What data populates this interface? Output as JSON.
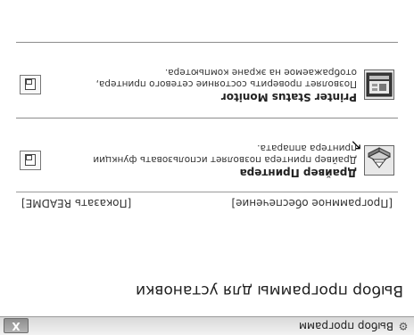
{
  "window": {
    "title": "Выбор программ",
    "title_icon": "gear-icon",
    "close_label": "X"
  },
  "main": {
    "heading": "Выбор программы для установки"
  },
  "tabs": {
    "software": "[Программное обеспечение]",
    "readme": "[Показать README]"
  },
  "items": [
    {
      "title": "Драйвер Принтера",
      "description": "Драйвер принтера позволяет использовать функции принтера аппарата.",
      "icon": "printer-driver-icon"
    },
    {
      "title": "Printer Status Monitor",
      "description": "Позволяет проверить состояние сетевого принтера, отображаемое на экране компьютера.",
      "icon": "status-monitor-icon"
    }
  ],
  "doc_icon": "document-icon"
}
